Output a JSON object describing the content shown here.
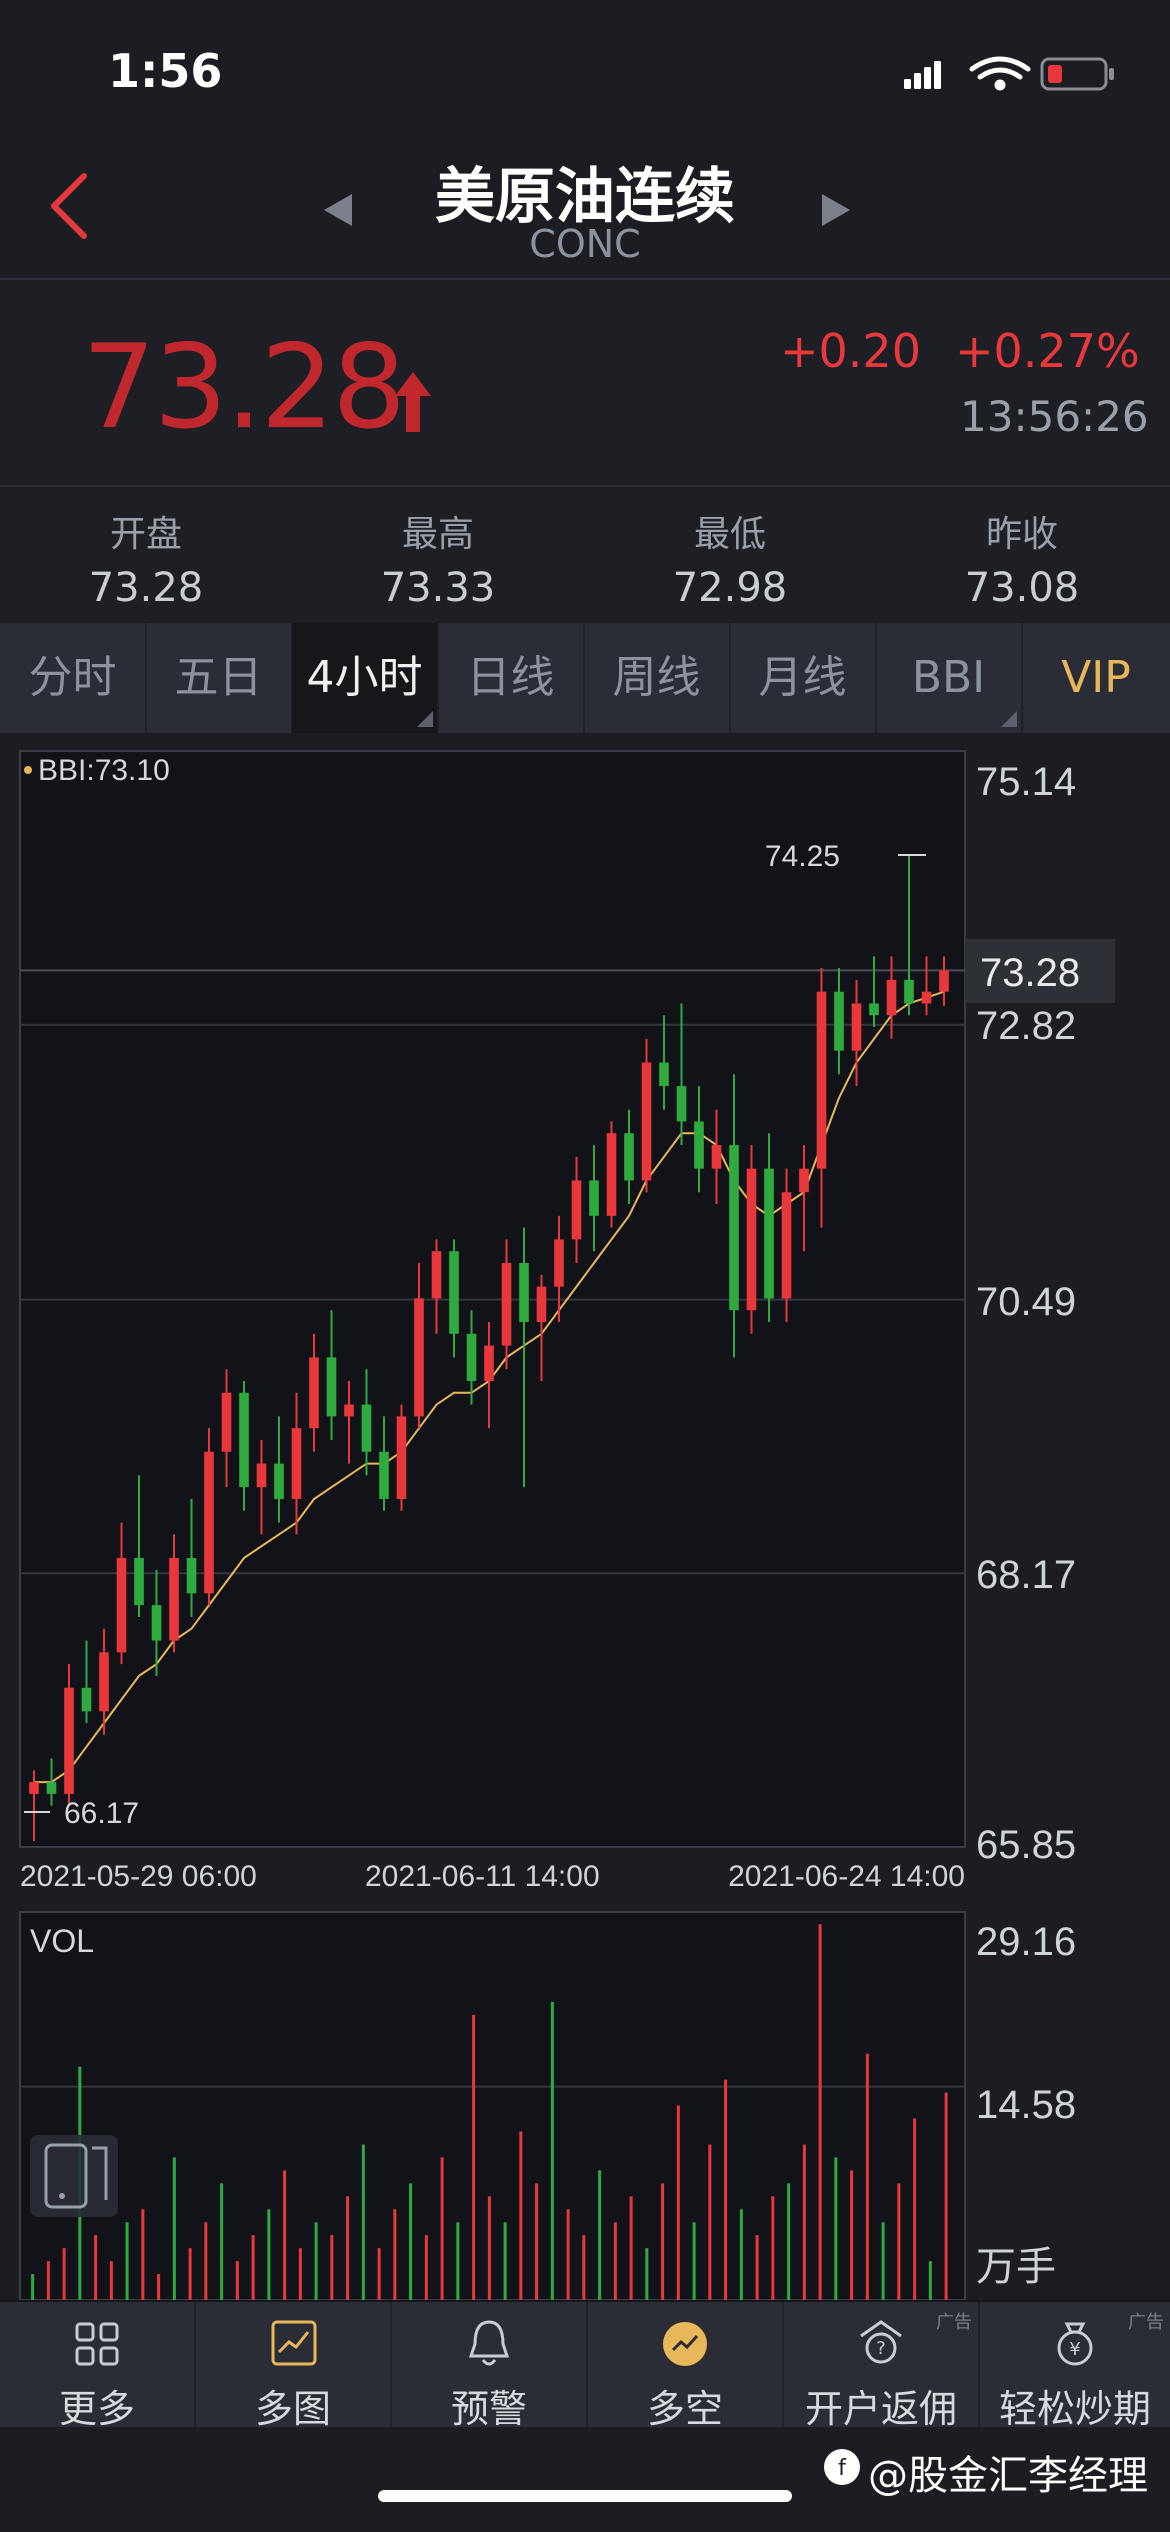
{
  "status": {
    "time": "1:56"
  },
  "header": {
    "title": "美原油连续",
    "code": "CONC"
  },
  "quote": {
    "price": "73.28",
    "change": "+0.20",
    "change_pct": "+0.27%",
    "timestamp": "13:56:26"
  },
  "stats": [
    {
      "label": "开盘",
      "value": "73.28"
    },
    {
      "label": "最高",
      "value": "73.33"
    },
    {
      "label": "最低",
      "value": "72.98"
    },
    {
      "label": "昨收",
      "value": "73.08"
    }
  ],
  "tabs": [
    "分时",
    "五日",
    "4小时",
    "日线",
    "周线",
    "月线",
    "BBI",
    "VIP"
  ],
  "active_tab": "4小时",
  "colors": {
    "up": "#e8383c",
    "down": "#2faa3e",
    "bbi": "#e8b75a",
    "accent": "#e8383c",
    "vip": "#e8b75a"
  },
  "chart": {
    "indicator_label": "BBI:73.10",
    "high_label": "74.25",
    "low_label": "66.17",
    "current_label": "73.28",
    "price_ticks": [
      "75.14",
      "72.82",
      "70.49",
      "68.17",
      "65.85"
    ],
    "date_labels": [
      "2021-05-29 06:00",
      "2021-06-11 14:00",
      "2021-06-24 14:00"
    ],
    "vol_label": "VOL",
    "vol_ticks": [
      "29.16",
      "14.58",
      "万手"
    ]
  },
  "chart_data": {
    "type": "candlestick",
    "ylim": [
      65.85,
      75.14
    ],
    "indicator": {
      "name": "BBI",
      "value": 73.1
    },
    "max_marker": 74.25,
    "min_marker": 66.17,
    "current_price": 73.28,
    "x_labels": [
      "2021-05-29 06:00",
      "2021-06-11 14:00",
      "2021-06-24 14:00"
    ],
    "candles": [
      [
        66.3,
        66.5,
        65.9,
        66.4
      ],
      [
        66.4,
        66.6,
        66.2,
        66.3
      ],
      [
        66.3,
        67.4,
        66.2,
        67.2
      ],
      [
        67.2,
        67.6,
        66.9,
        67.0
      ],
      [
        67.0,
        67.7,
        66.8,
        67.5
      ],
      [
        67.5,
        68.6,
        67.4,
        68.3
      ],
      [
        68.3,
        69.0,
        67.8,
        67.9
      ],
      [
        67.9,
        68.2,
        67.3,
        67.6
      ],
      [
        67.6,
        68.5,
        67.5,
        68.3
      ],
      [
        68.3,
        68.8,
        67.8,
        68.0
      ],
      [
        68.0,
        69.4,
        67.9,
        69.2
      ],
      [
        69.2,
        69.9,
        68.9,
        69.7
      ],
      [
        69.7,
        69.8,
        68.7,
        68.9
      ],
      [
        68.9,
        69.3,
        68.5,
        69.1
      ],
      [
        69.1,
        69.5,
        68.6,
        68.8
      ],
      [
        68.8,
        69.7,
        68.5,
        69.4
      ],
      [
        69.4,
        70.2,
        69.2,
        70.0
      ],
      [
        70.0,
        70.4,
        69.3,
        69.5
      ],
      [
        69.5,
        69.8,
        69.1,
        69.6
      ],
      [
        69.6,
        69.9,
        69.0,
        69.2
      ],
      [
        69.2,
        69.5,
        68.7,
        68.8
      ],
      [
        68.8,
        69.6,
        68.7,
        69.5
      ],
      [
        69.5,
        70.8,
        69.4,
        70.5
      ],
      [
        70.5,
        71.0,
        70.2,
        70.9
      ],
      [
        70.9,
        71.0,
        70.0,
        70.2
      ],
      [
        70.2,
        70.4,
        69.6,
        69.8
      ],
      [
        69.8,
        70.3,
        69.4,
        70.1
      ],
      [
        70.1,
        71.0,
        69.9,
        70.8
      ],
      [
        70.8,
        71.1,
        68.9,
        70.3
      ],
      [
        70.3,
        70.7,
        69.8,
        70.6
      ],
      [
        70.6,
        71.2,
        70.3,
        71.0
      ],
      [
        71.0,
        71.7,
        70.8,
        71.5
      ],
      [
        71.5,
        71.8,
        70.9,
        71.2
      ],
      [
        71.2,
        72.0,
        71.1,
        71.9
      ],
      [
        71.9,
        72.1,
        71.3,
        71.5
      ],
      [
        71.5,
        72.7,
        71.4,
        72.5
      ],
      [
        72.5,
        72.9,
        72.1,
        72.3
      ],
      [
        72.3,
        73.0,
        71.8,
        72.0
      ],
      [
        72.0,
        72.3,
        71.4,
        71.6
      ],
      [
        71.6,
        72.1,
        71.3,
        71.8
      ],
      [
        71.8,
        72.4,
        70.0,
        70.4
      ],
      [
        70.4,
        71.8,
        70.2,
        71.6
      ],
      [
        71.6,
        71.9,
        70.3,
        70.5
      ],
      [
        70.5,
        71.6,
        70.3,
        71.4
      ],
      [
        71.4,
        71.8,
        70.9,
        71.6
      ],
      [
        71.6,
        73.3,
        71.1,
        73.1
      ],
      [
        73.1,
        73.3,
        72.4,
        72.6
      ],
      [
        72.6,
        73.2,
        72.3,
        73.0
      ],
      [
        73.0,
        73.4,
        72.8,
        72.9
      ],
      [
        72.9,
        73.4,
        72.7,
        73.2
      ],
      [
        73.2,
        74.25,
        72.9,
        73.0
      ],
      [
        73.0,
        73.4,
        72.9,
        73.1
      ],
      [
        73.1,
        73.4,
        72.98,
        73.28
      ]
    ],
    "bbi": [
      66.4,
      66.4,
      66.5,
      66.7,
      66.9,
      67.1,
      67.3,
      67.4,
      67.6,
      67.7,
      67.9,
      68.1,
      68.3,
      68.4,
      68.5,
      68.6,
      68.8,
      68.9,
      69.0,
      69.1,
      69.1,
      69.2,
      69.4,
      69.6,
      69.7,
      69.7,
      69.8,
      70.0,
      70.1,
      70.2,
      70.4,
      70.6,
      70.8,
      71.0,
      71.2,
      71.5,
      71.7,
      71.9,
      71.9,
      71.8,
      71.5,
      71.3,
      71.2,
      71.3,
      71.4,
      71.8,
      72.2,
      72.5,
      72.7,
      72.9,
      73.0,
      73.05,
      73.1
    ],
    "volume": {
      "unit": "万手",
      "ylim": [
        0,
        29.16
      ],
      "values": [
        2,
        3,
        4,
        18,
        5,
        3,
        6,
        7,
        2,
        11,
        4,
        6,
        9,
        3,
        5,
        7,
        10,
        4,
        6,
        5,
        8,
        12,
        4,
        7,
        9,
        5,
        11,
        6,
        22,
        8,
        6,
        13,
        9,
        23,
        7,
        5,
        10,
        6,
        8,
        4,
        9,
        15,
        6,
        12,
        17,
        7,
        5,
        8,
        9,
        12,
        29,
        11,
        10,
        19,
        6,
        9,
        14,
        3,
        16
      ]
    }
  },
  "toolbar": [
    {
      "label": "更多",
      "icon": "grid-icon",
      "ad": ""
    },
    {
      "label": "多图",
      "icon": "multi-chart-icon",
      "ad": ""
    },
    {
      "label": "预警",
      "icon": "bell-icon",
      "ad": ""
    },
    {
      "label": "多空",
      "icon": "trend-icon",
      "ad": ""
    },
    {
      "label": "开户返佣",
      "icon": "gift-icon",
      "ad": "广告"
    },
    {
      "label": "轻松炒期",
      "icon": "money-bag-icon",
      "ad": "广告"
    }
  ],
  "watermark": "@股金汇李经理"
}
